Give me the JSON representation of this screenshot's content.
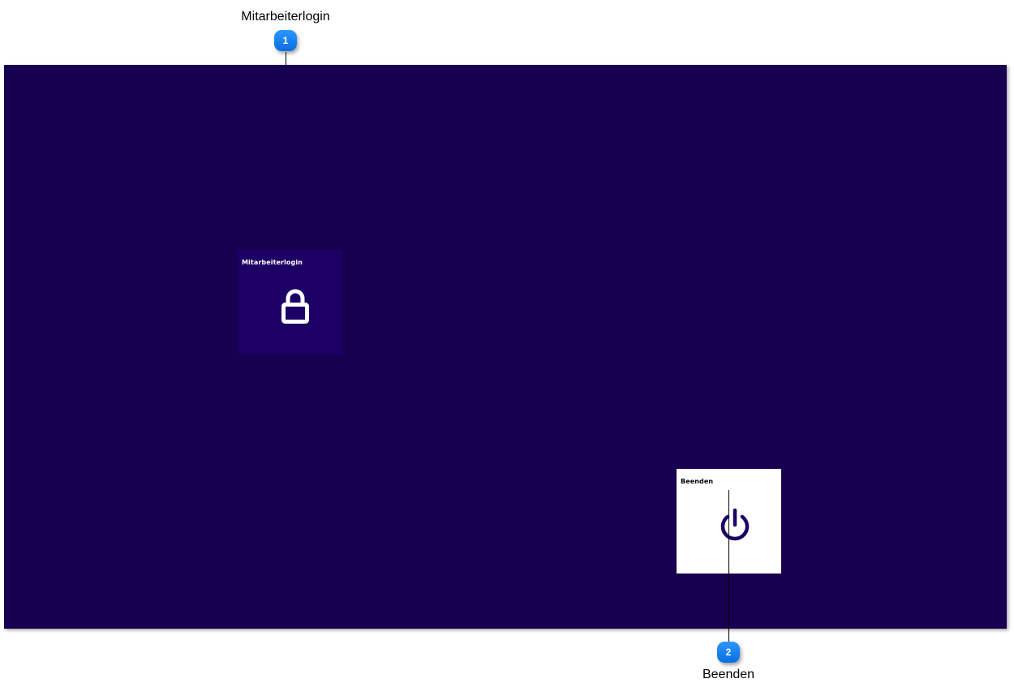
{
  "app": {
    "background_color": "#170050",
    "tiles": [
      {
        "label": "Mitarbeiterlogin",
        "icon": "lock-icon",
        "background": "#1d0066",
        "text_color": "#ffffff"
      },
      {
        "label": "Beenden",
        "icon": "power-icon",
        "background": "#ffffff",
        "text_color": "#000000"
      }
    ]
  },
  "callouts": [
    {
      "number": "1",
      "label": "Mitarbeiterlogin"
    },
    {
      "number": "2",
      "label": "Beenden"
    }
  ],
  "colors": {
    "badge": "#0a6fe0",
    "screen": "#170050"
  }
}
